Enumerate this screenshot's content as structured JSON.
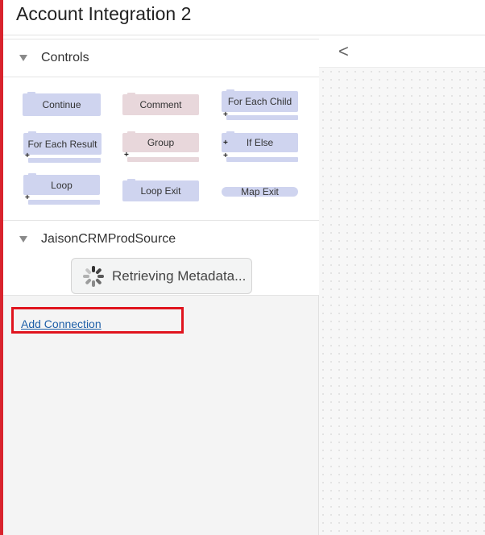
{
  "header": {
    "title": "Account Integration 2"
  },
  "controls": {
    "section_label": "Controls",
    "blocks": {
      "continue": "Continue",
      "comment": "Comment",
      "for_each_child": "For Each Child",
      "for_each_result": "For Each Result",
      "group": "Group",
      "if_else": "If Else",
      "loop": "Loop",
      "loop_exit": "Loop Exit",
      "map_exit": "Map Exit"
    },
    "plus_glyph": "+"
  },
  "source": {
    "section_label": "JaisonCRMProdSource",
    "status_text": "Retrieving Metadata..."
  },
  "add_connection": {
    "label": "Add Connection"
  },
  "canvas": {
    "collapse_glyph": "<"
  },
  "colors": {
    "accent_red": "#d9232d",
    "highlight_box": "#e0141e",
    "block_blue": "#cfd4ef",
    "block_pink": "#e8d7db",
    "link_blue": "#1e5fa8"
  }
}
